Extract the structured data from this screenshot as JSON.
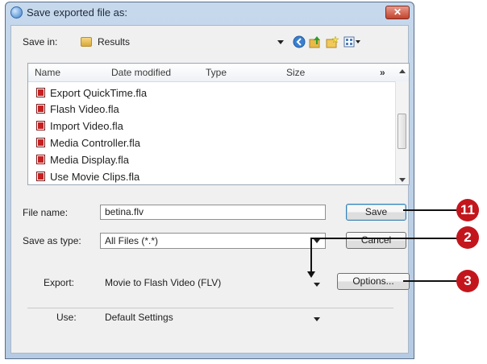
{
  "window": {
    "title": "Save exported file as:",
    "close_label": "✕"
  },
  "save_in": {
    "label": "Save in:",
    "folder": "Results"
  },
  "toolbar_icons": [
    "back-icon",
    "up-folder-icon",
    "new-folder-icon",
    "views-icon"
  ],
  "columns": [
    "Name",
    "Date modified",
    "Type",
    "Size",
    "»"
  ],
  "files": [
    "Export QuickTime.fla",
    "Flash Video.fla",
    "Import Video.fla",
    "Media Controller.fla",
    "Media Display.fla",
    "Use Movie Clips.fla"
  ],
  "file_name": {
    "label": "File name:",
    "value": "betina.flv"
  },
  "save_as_type": {
    "label": "Save as type:",
    "value": "All Files (*.*)"
  },
  "buttons": {
    "save": "Save",
    "cancel": "Cancel",
    "options": "Options..."
  },
  "export": {
    "label": "Export:",
    "value": "Movie to Flash Video (FLV)"
  },
  "use": {
    "label": "Use:",
    "value": "Default Settings"
  },
  "callouts": [
    "11",
    "2",
    "3"
  ],
  "colors": {
    "callout": "#c3161c",
    "dialog_frame": "#b5cbe3",
    "client_bg": "#f0f0f0"
  }
}
